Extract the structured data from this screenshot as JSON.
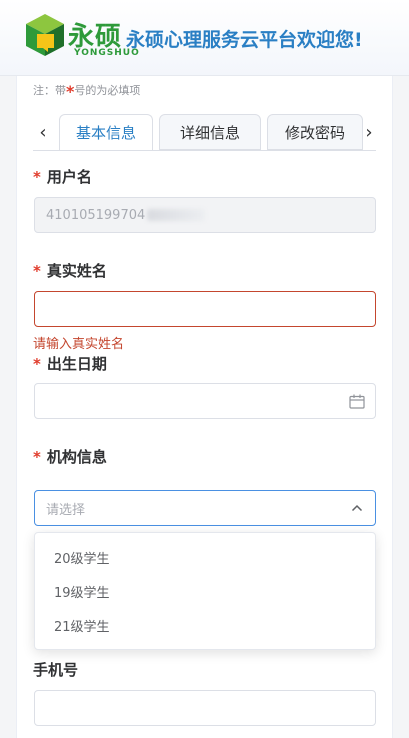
{
  "header": {
    "brand_cn": "永硕",
    "brand_en": "YONGSHUO",
    "welcome": "永硕心理服务云平台欢迎您!",
    "logo_icon": "cube-logo-icon",
    "brand_color": "#2e9a3a",
    "welcome_color": "#2a7fc4"
  },
  "note": {
    "prefix": "注：带",
    "star": "*",
    "suffix": "号的为必填项"
  },
  "tabs": {
    "prev_arrow": "‹",
    "next_arrow": "›",
    "items": [
      {
        "label": "基本信息",
        "active": true
      },
      {
        "label": "详细信息",
        "active": false
      },
      {
        "label": "修改密码",
        "active": false
      }
    ]
  },
  "form": {
    "required_mark": "*",
    "username": {
      "label": "用户名",
      "value": "410105199704",
      "disabled": true
    },
    "realname": {
      "label": "真实姓名",
      "value": "",
      "error": "请输入真实姓名"
    },
    "birthdate": {
      "label": "出生日期",
      "value": "",
      "icon": "calendar-icon"
    },
    "org": {
      "label": "机构信息",
      "placeholder": "请选择",
      "icon": "chevron-up-icon",
      "options": [
        "20级学生",
        "19级学生",
        "21级学生"
      ]
    },
    "phone": {
      "label": "手机号",
      "value": ""
    }
  },
  "colors": {
    "required": "#e03b2b",
    "error": "#c4462e",
    "accent": "#2a7fc4",
    "focus_border": "#4a90e2"
  }
}
